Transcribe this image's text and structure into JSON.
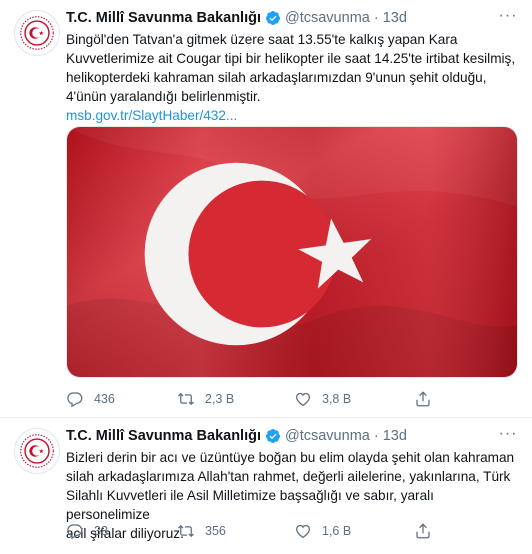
{
  "tweets": [
    {
      "author": {
        "name": "T.C. Millî Savunma Bakanlığı",
        "handle": "@tcsavunma",
        "time": "13d"
      },
      "text": "Bingöl'den Tatvan'a gitmek üzere saat 13.55'te kalkış yapan Kara\nKuvvetlerimize ait Cougar tipi bir helikopter ile saat 14.25'te irtibat kesilmiş,\nhelikopterdeki kahraman silah arkadaşlarımızdan 9'unun şehit olduğu,\n4'ünün yaralandığı belirlenmiştir.",
      "link": "msb.gov.tr/SlaytHaber/432...",
      "stats": {
        "replies": "436",
        "retweets": "2,3 B",
        "likes": "3,8 B"
      }
    },
    {
      "author": {
        "name": "T.C. Millî Savunma Bakanlığı",
        "handle": "@tcsavunma",
        "time": "13d"
      },
      "text": "Bizleri derin bir acı ve üzüntüye boğan bu elim olayda şehit olan kahraman\nsilah arkadaşlarımıza Allah'tan rahmet, değerli ailelerine, yakınlarına, Türk\nSilahlı Kuvvetleri ile Asil Milletimize başsağlığı ve sabır, yaralı personelimize\nacil şifalar diliyoruz.",
      "stats": {
        "replies": "33",
        "retweets": "356",
        "likes": "1,6 B"
      }
    }
  ],
  "colors": {
    "accent": "#1da1f2",
    "link": "#1b95e0",
    "muted": "#5b7083",
    "flag_red": "#e30a17"
  },
  "icons": {
    "verified": "verified-badge-icon",
    "more": "more-options-icon",
    "reply": "reply-icon",
    "retweet": "retweet-icon",
    "like": "heart-icon",
    "share": "share-icon"
  }
}
